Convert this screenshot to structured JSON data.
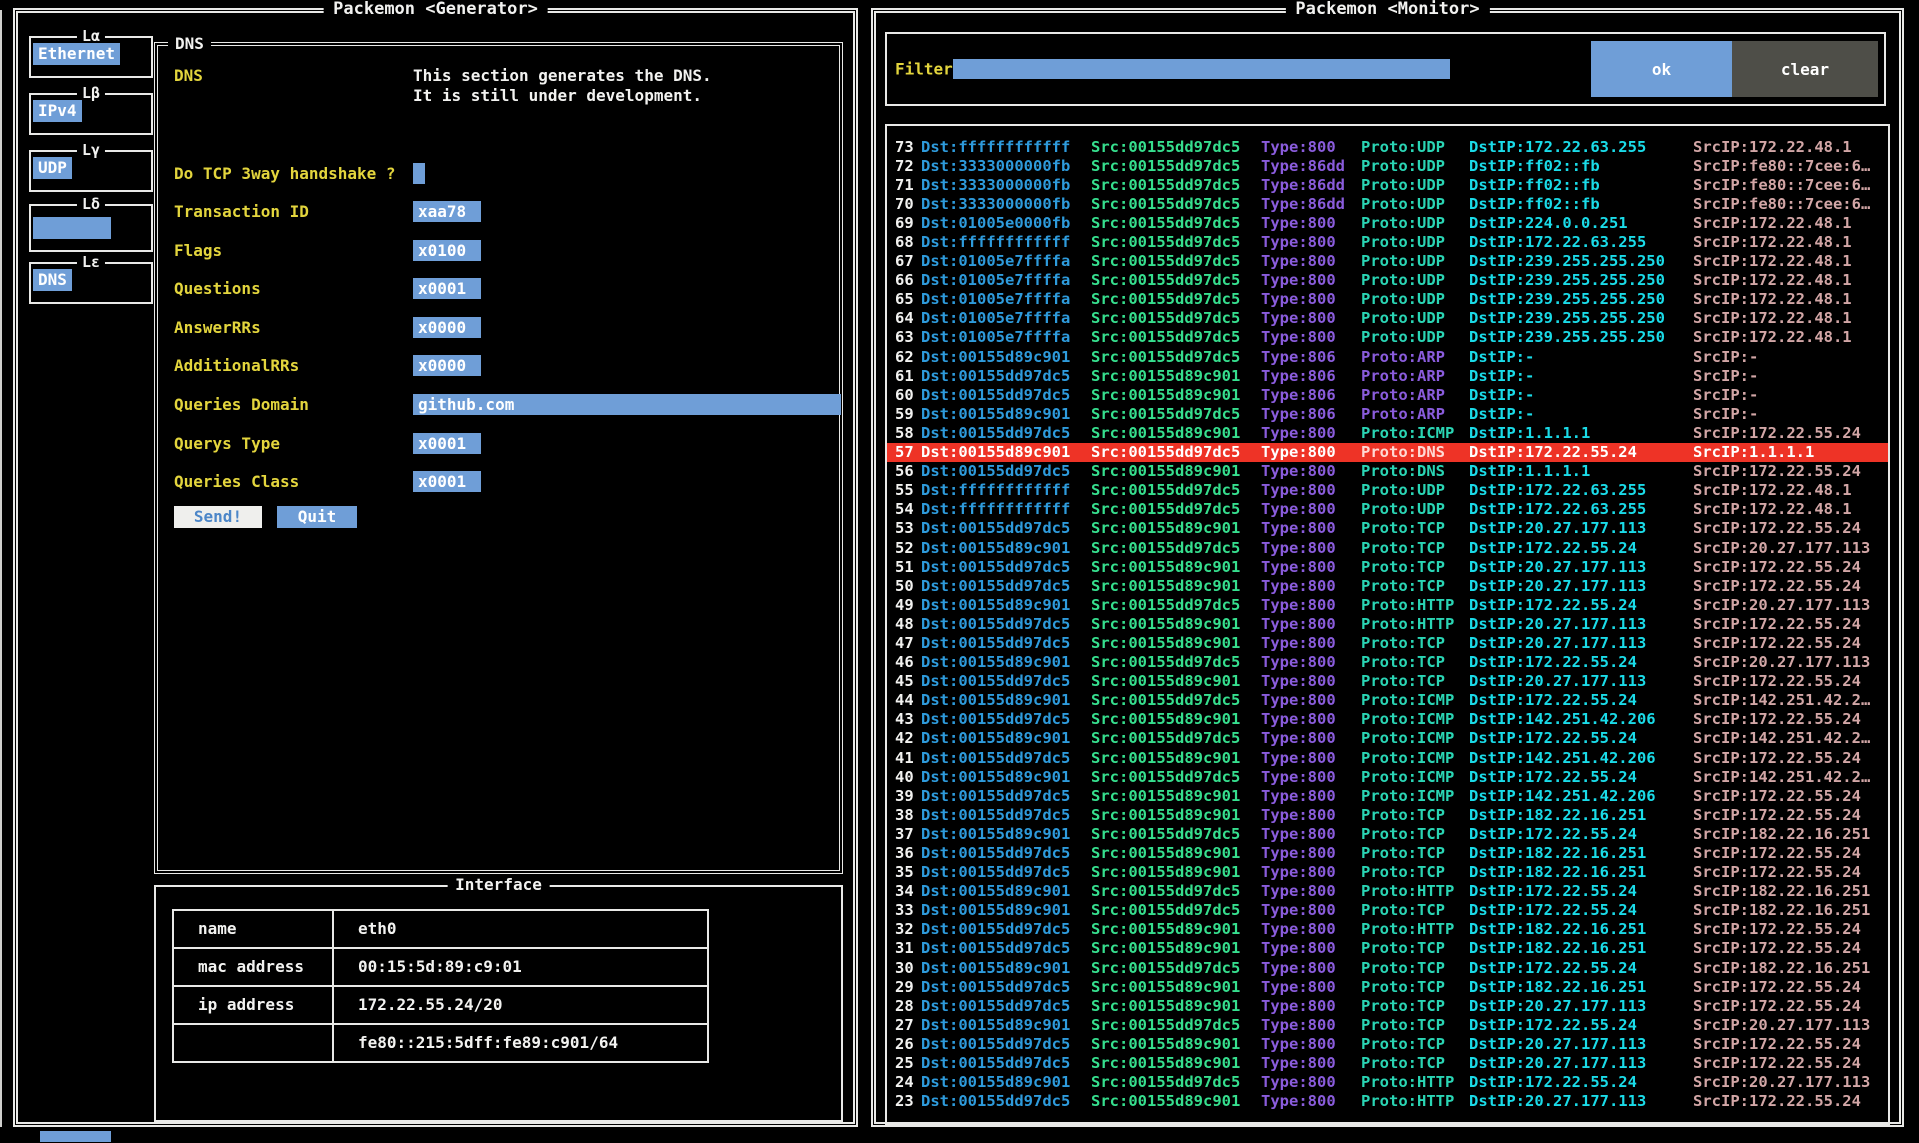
{
  "generator": {
    "title": "Packemon <Generator>",
    "layers": [
      {
        "label": "Lα",
        "value": "Ethernet"
      },
      {
        "label": "Lβ",
        "value": "IPv4"
      },
      {
        "label": "Lγ",
        "value": "UDP"
      },
      {
        "label": "Lδ",
        "value": ""
      },
      {
        "label": "Lε",
        "value": "DNS"
      }
    ],
    "dns_section": {
      "box_title": "DNS",
      "label": "DNS",
      "description_line1": "This section generates the DNS.",
      "description_line2": "It is still under development.",
      "checkbox_label": "Do TCP 3way handshake ?",
      "fields": [
        {
          "label": "Transaction ID",
          "value": "xaa78",
          "wide": false
        },
        {
          "label": "Flags",
          "value": "x0100",
          "wide": false
        },
        {
          "label": "Questions",
          "value": "x0001",
          "wide": false
        },
        {
          "label": "AnswerRRs",
          "value": "x0000",
          "wide": false
        },
        {
          "label": "AdditionalRRs",
          "value": "x0000",
          "wide": false
        },
        {
          "label": "Queries Domain",
          "value": "github.com",
          "wide": true
        },
        {
          "label": "Querys Type",
          "value": "x0001",
          "wide": false
        },
        {
          "label": "Queries Class",
          "value": "x0001",
          "wide": false
        }
      ],
      "send_label": "Send!",
      "quit_label": "Quit"
    },
    "interface_section": {
      "box_title": "Interface",
      "rows": [
        {
          "key": "name",
          "value": "eth0"
        },
        {
          "key": "mac address",
          "value": "00:15:5d:89:c9:01"
        },
        {
          "key": "ip address",
          "value": "172.22.55.24/20"
        },
        {
          "key": "",
          "value": "fe80::215:5dff:fe89:c901/64"
        }
      ]
    }
  },
  "monitor": {
    "title": "Packemon <Monitor>",
    "filter_label": "Filter",
    "filter_value": "",
    "ok_label": "ok",
    "clear_label": "clear",
    "column_prefixes": {
      "dst": "Dst:",
      "src": "Src:",
      "type": "Type:",
      "proto": "Proto:",
      "dstip": "DstIP:",
      "srcip": "SrcIP:"
    },
    "packets": [
      {
        "no": "73",
        "dst": "ffffffffffff",
        "src": "00155dd97dc5",
        "type": "800",
        "proto": "UDP",
        "dstip": "172.22.63.255",
        "srcip": "172.22.48.1",
        "highlighted": false
      },
      {
        "no": "72",
        "dst": "3333000000fb",
        "src": "00155dd97dc5",
        "type": "86dd",
        "proto": "UDP",
        "dstip": "ff02::fb",
        "srcip": "fe80::7cee:6…",
        "highlighted": false
      },
      {
        "no": "71",
        "dst": "3333000000fb",
        "src": "00155dd97dc5",
        "type": "86dd",
        "proto": "UDP",
        "dstip": "ff02::fb",
        "srcip": "fe80::7cee:6…",
        "highlighted": false
      },
      {
        "no": "70",
        "dst": "3333000000fb",
        "src": "00155dd97dc5",
        "type": "86dd",
        "proto": "UDP",
        "dstip": "ff02::fb",
        "srcip": "fe80::7cee:6…",
        "highlighted": false
      },
      {
        "no": "69",
        "dst": "01005e0000fb",
        "src": "00155dd97dc5",
        "type": "800",
        "proto": "UDP",
        "dstip": "224.0.0.251",
        "srcip": "172.22.48.1",
        "highlighted": false
      },
      {
        "no": "68",
        "dst": "ffffffffffff",
        "src": "00155dd97dc5",
        "type": "800",
        "proto": "UDP",
        "dstip": "172.22.63.255",
        "srcip": "172.22.48.1",
        "highlighted": false
      },
      {
        "no": "67",
        "dst": "01005e7ffffa",
        "src": "00155dd97dc5",
        "type": "800",
        "proto": "UDP",
        "dstip": "239.255.255.250",
        "srcip": "172.22.48.1",
        "highlighted": false
      },
      {
        "no": "66",
        "dst": "01005e7ffffa",
        "src": "00155dd97dc5",
        "type": "800",
        "proto": "UDP",
        "dstip": "239.255.255.250",
        "srcip": "172.22.48.1",
        "highlighted": false
      },
      {
        "no": "65",
        "dst": "01005e7ffffa",
        "src": "00155dd97dc5",
        "type": "800",
        "proto": "UDP",
        "dstip": "239.255.255.250",
        "srcip": "172.22.48.1",
        "highlighted": false
      },
      {
        "no": "64",
        "dst": "01005e7ffffa",
        "src": "00155dd97dc5",
        "type": "800",
        "proto": "UDP",
        "dstip": "239.255.255.250",
        "srcip": "172.22.48.1",
        "highlighted": false
      },
      {
        "no": "63",
        "dst": "01005e7ffffa",
        "src": "00155dd97dc5",
        "type": "800",
        "proto": "UDP",
        "dstip": "239.255.255.250",
        "srcip": "172.22.48.1",
        "highlighted": false
      },
      {
        "no": "62",
        "dst": "00155d89c901",
        "src": "00155dd97dc5",
        "type": "806",
        "proto": "ARP",
        "dstip": "-",
        "srcip": "-",
        "highlighted": false
      },
      {
        "no": "61",
        "dst": "00155dd97dc5",
        "src": "00155d89c901",
        "type": "806",
        "proto": "ARP",
        "dstip": "-",
        "srcip": "-",
        "highlighted": false
      },
      {
        "no": "60",
        "dst": "00155dd97dc5",
        "src": "00155d89c901",
        "type": "806",
        "proto": "ARP",
        "dstip": "-",
        "srcip": "-",
        "highlighted": false
      },
      {
        "no": "59",
        "dst": "00155d89c901",
        "src": "00155dd97dc5",
        "type": "806",
        "proto": "ARP",
        "dstip": "-",
        "srcip": "-",
        "highlighted": false
      },
      {
        "no": "58",
        "dst": "00155dd97dc5",
        "src": "00155d89c901",
        "type": "800",
        "proto": "ICMP",
        "dstip": "1.1.1.1",
        "srcip": "172.22.55.24",
        "highlighted": false
      },
      {
        "no": "57",
        "dst": "00155d89c901",
        "src": "00155dd97dc5",
        "type": "800",
        "proto": "DNS",
        "dstip": "172.22.55.24",
        "srcip": "1.1.1.1",
        "highlighted": true
      },
      {
        "no": "56",
        "dst": "00155dd97dc5",
        "src": "00155d89c901",
        "type": "800",
        "proto": "DNS",
        "dstip": "1.1.1.1",
        "srcip": "172.22.55.24",
        "highlighted": false
      },
      {
        "no": "55",
        "dst": "ffffffffffff",
        "src": "00155dd97dc5",
        "type": "800",
        "proto": "UDP",
        "dstip": "172.22.63.255",
        "srcip": "172.22.48.1",
        "highlighted": false
      },
      {
        "no": "54",
        "dst": "ffffffffffff",
        "src": "00155dd97dc5",
        "type": "800",
        "proto": "UDP",
        "dstip": "172.22.63.255",
        "srcip": "172.22.48.1",
        "highlighted": false
      },
      {
        "no": "53",
        "dst": "00155dd97dc5",
        "src": "00155d89c901",
        "type": "800",
        "proto": "TCP",
        "dstip": "20.27.177.113",
        "srcip": "172.22.55.24",
        "highlighted": false
      },
      {
        "no": "52",
        "dst": "00155d89c901",
        "src": "00155dd97dc5",
        "type": "800",
        "proto": "TCP",
        "dstip": "172.22.55.24",
        "srcip": "20.27.177.113",
        "highlighted": false
      },
      {
        "no": "51",
        "dst": "00155dd97dc5",
        "src": "00155d89c901",
        "type": "800",
        "proto": "TCP",
        "dstip": "20.27.177.113",
        "srcip": "172.22.55.24",
        "highlighted": false
      },
      {
        "no": "50",
        "dst": "00155dd97dc5",
        "src": "00155d89c901",
        "type": "800",
        "proto": "TCP",
        "dstip": "20.27.177.113",
        "srcip": "172.22.55.24",
        "highlighted": false
      },
      {
        "no": "49",
        "dst": "00155d89c901",
        "src": "00155dd97dc5",
        "type": "800",
        "proto": "HTTP",
        "dstip": "172.22.55.24",
        "srcip": "20.27.177.113",
        "highlighted": false
      },
      {
        "no": "48",
        "dst": "00155dd97dc5",
        "src": "00155d89c901",
        "type": "800",
        "proto": "HTTP",
        "dstip": "20.27.177.113",
        "srcip": "172.22.55.24",
        "highlighted": false
      },
      {
        "no": "47",
        "dst": "00155dd97dc5",
        "src": "00155d89c901",
        "type": "800",
        "proto": "TCP",
        "dstip": "20.27.177.113",
        "srcip": "172.22.55.24",
        "highlighted": false
      },
      {
        "no": "46",
        "dst": "00155d89c901",
        "src": "00155dd97dc5",
        "type": "800",
        "proto": "TCP",
        "dstip": "172.22.55.24",
        "srcip": "20.27.177.113",
        "highlighted": false
      },
      {
        "no": "45",
        "dst": "00155dd97dc5",
        "src": "00155d89c901",
        "type": "800",
        "proto": "TCP",
        "dstip": "20.27.177.113",
        "srcip": "172.22.55.24",
        "highlighted": false
      },
      {
        "no": "44",
        "dst": "00155d89c901",
        "src": "00155dd97dc5",
        "type": "800",
        "proto": "ICMP",
        "dstip": "172.22.55.24",
        "srcip": "142.251.42.2…",
        "highlighted": false
      },
      {
        "no": "43",
        "dst": "00155dd97dc5",
        "src": "00155d89c901",
        "type": "800",
        "proto": "ICMP",
        "dstip": "142.251.42.206",
        "srcip": "172.22.55.24",
        "highlighted": false
      },
      {
        "no": "42",
        "dst": "00155d89c901",
        "src": "00155dd97dc5",
        "type": "800",
        "proto": "ICMP",
        "dstip": "172.22.55.24",
        "srcip": "142.251.42.2…",
        "highlighted": false
      },
      {
        "no": "41",
        "dst": "00155dd97dc5",
        "src": "00155d89c901",
        "type": "800",
        "proto": "ICMP",
        "dstip": "142.251.42.206",
        "srcip": "172.22.55.24",
        "highlighted": false
      },
      {
        "no": "40",
        "dst": "00155d89c901",
        "src": "00155dd97dc5",
        "type": "800",
        "proto": "ICMP",
        "dstip": "172.22.55.24",
        "srcip": "142.251.42.2…",
        "highlighted": false
      },
      {
        "no": "39",
        "dst": "00155dd97dc5",
        "src": "00155d89c901",
        "type": "800",
        "proto": "ICMP",
        "dstip": "142.251.42.206",
        "srcip": "172.22.55.24",
        "highlighted": false
      },
      {
        "no": "38",
        "dst": "00155dd97dc5",
        "src": "00155d89c901",
        "type": "800",
        "proto": "TCP",
        "dstip": "182.22.16.251",
        "srcip": "172.22.55.24",
        "highlighted": false
      },
      {
        "no": "37",
        "dst": "00155d89c901",
        "src": "00155dd97dc5",
        "type": "800",
        "proto": "TCP",
        "dstip": "172.22.55.24",
        "srcip": "182.22.16.251",
        "highlighted": false
      },
      {
        "no": "36",
        "dst": "00155dd97dc5",
        "src": "00155d89c901",
        "type": "800",
        "proto": "TCP",
        "dstip": "182.22.16.251",
        "srcip": "172.22.55.24",
        "highlighted": false
      },
      {
        "no": "35",
        "dst": "00155dd97dc5",
        "src": "00155d89c901",
        "type": "800",
        "proto": "TCP",
        "dstip": "182.22.16.251",
        "srcip": "172.22.55.24",
        "highlighted": false
      },
      {
        "no": "34",
        "dst": "00155d89c901",
        "src": "00155dd97dc5",
        "type": "800",
        "proto": "HTTP",
        "dstip": "172.22.55.24",
        "srcip": "182.22.16.251",
        "highlighted": false
      },
      {
        "no": "33",
        "dst": "00155d89c901",
        "src": "00155dd97dc5",
        "type": "800",
        "proto": "TCP",
        "dstip": "172.22.55.24",
        "srcip": "182.22.16.251",
        "highlighted": false
      },
      {
        "no": "32",
        "dst": "00155dd97dc5",
        "src": "00155d89c901",
        "type": "800",
        "proto": "HTTP",
        "dstip": "182.22.16.251",
        "srcip": "172.22.55.24",
        "highlighted": false
      },
      {
        "no": "31",
        "dst": "00155dd97dc5",
        "src": "00155d89c901",
        "type": "800",
        "proto": "TCP",
        "dstip": "182.22.16.251",
        "srcip": "172.22.55.24",
        "highlighted": false
      },
      {
        "no": "30",
        "dst": "00155d89c901",
        "src": "00155dd97dc5",
        "type": "800",
        "proto": "TCP",
        "dstip": "172.22.55.24",
        "srcip": "182.22.16.251",
        "highlighted": false
      },
      {
        "no": "29",
        "dst": "00155dd97dc5",
        "src": "00155d89c901",
        "type": "800",
        "proto": "TCP",
        "dstip": "182.22.16.251",
        "srcip": "172.22.55.24",
        "highlighted": false
      },
      {
        "no": "28",
        "dst": "00155dd97dc5",
        "src": "00155d89c901",
        "type": "800",
        "proto": "TCP",
        "dstip": "20.27.177.113",
        "srcip": "172.22.55.24",
        "highlighted": false
      },
      {
        "no": "27",
        "dst": "00155d89c901",
        "src": "00155dd97dc5",
        "type": "800",
        "proto": "TCP",
        "dstip": "172.22.55.24",
        "srcip": "20.27.177.113",
        "highlighted": false
      },
      {
        "no": "26",
        "dst": "00155dd97dc5",
        "src": "00155d89c901",
        "type": "800",
        "proto": "TCP",
        "dstip": "20.27.177.113",
        "srcip": "172.22.55.24",
        "highlighted": false
      },
      {
        "no": "25",
        "dst": "00155dd97dc5",
        "src": "00155d89c901",
        "type": "800",
        "proto": "TCP",
        "dstip": "20.27.177.113",
        "srcip": "172.22.55.24",
        "highlighted": false
      },
      {
        "no": "24",
        "dst": "00155d89c901",
        "src": "00155dd97dc5",
        "type": "800",
        "proto": "HTTP",
        "dstip": "172.22.55.24",
        "srcip": "20.27.177.113",
        "highlighted": false
      },
      {
        "no": "23",
        "dst": "00155dd97dc5",
        "src": "00155d89c901",
        "type": "800",
        "proto": "HTTP",
        "dstip": "20.27.177.113",
        "srcip": "172.22.55.24",
        "highlighted": false
      }
    ]
  },
  "colors": {
    "highlight_blue": "#6f9ed7",
    "label_yellow": "#e3d53d",
    "dst_blue": "#2e9bdc",
    "src_green": "#36df8e",
    "type_purple": "#8a5cdc",
    "proto_teal": "#2ad5b4",
    "dstip_cyan": "#1adbe8",
    "srcip_rose": "#d2a6a6",
    "selected_red": "#ee3326",
    "clear_gray": "#4e4e48"
  }
}
